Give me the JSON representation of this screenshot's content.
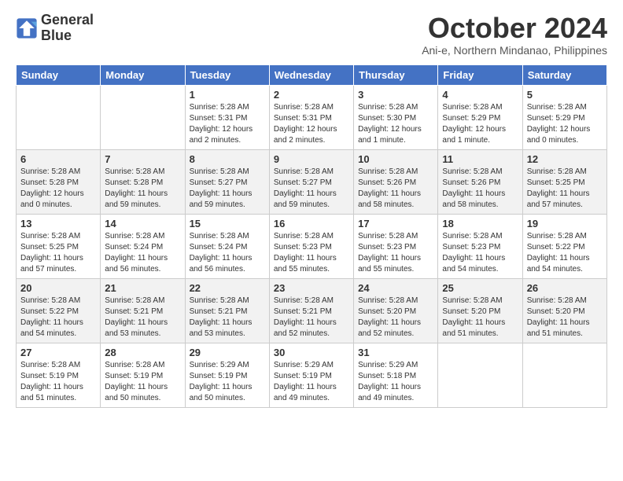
{
  "header": {
    "logo_line1": "General",
    "logo_line2": "Blue",
    "month_title": "October 2024",
    "subtitle": "Ani-e, Northern Mindanao, Philippines"
  },
  "days_of_week": [
    "Sunday",
    "Monday",
    "Tuesday",
    "Wednesday",
    "Thursday",
    "Friday",
    "Saturday"
  ],
  "weeks": [
    [
      {
        "day": "",
        "content": ""
      },
      {
        "day": "",
        "content": ""
      },
      {
        "day": "1",
        "content": "Sunrise: 5:28 AM\nSunset: 5:31 PM\nDaylight: 12 hours and 2 minutes."
      },
      {
        "day": "2",
        "content": "Sunrise: 5:28 AM\nSunset: 5:31 PM\nDaylight: 12 hours and 2 minutes."
      },
      {
        "day": "3",
        "content": "Sunrise: 5:28 AM\nSunset: 5:30 PM\nDaylight: 12 hours and 1 minute."
      },
      {
        "day": "4",
        "content": "Sunrise: 5:28 AM\nSunset: 5:29 PM\nDaylight: 12 hours and 1 minute."
      },
      {
        "day": "5",
        "content": "Sunrise: 5:28 AM\nSunset: 5:29 PM\nDaylight: 12 hours and 0 minutes."
      }
    ],
    [
      {
        "day": "6",
        "content": "Sunrise: 5:28 AM\nSunset: 5:28 PM\nDaylight: 12 hours and 0 minutes."
      },
      {
        "day": "7",
        "content": "Sunrise: 5:28 AM\nSunset: 5:28 PM\nDaylight: 11 hours and 59 minutes."
      },
      {
        "day": "8",
        "content": "Sunrise: 5:28 AM\nSunset: 5:27 PM\nDaylight: 11 hours and 59 minutes."
      },
      {
        "day": "9",
        "content": "Sunrise: 5:28 AM\nSunset: 5:27 PM\nDaylight: 11 hours and 59 minutes."
      },
      {
        "day": "10",
        "content": "Sunrise: 5:28 AM\nSunset: 5:26 PM\nDaylight: 11 hours and 58 minutes."
      },
      {
        "day": "11",
        "content": "Sunrise: 5:28 AM\nSunset: 5:26 PM\nDaylight: 11 hours and 58 minutes."
      },
      {
        "day": "12",
        "content": "Sunrise: 5:28 AM\nSunset: 5:25 PM\nDaylight: 11 hours and 57 minutes."
      }
    ],
    [
      {
        "day": "13",
        "content": "Sunrise: 5:28 AM\nSunset: 5:25 PM\nDaylight: 11 hours and 57 minutes."
      },
      {
        "day": "14",
        "content": "Sunrise: 5:28 AM\nSunset: 5:24 PM\nDaylight: 11 hours and 56 minutes."
      },
      {
        "day": "15",
        "content": "Sunrise: 5:28 AM\nSunset: 5:24 PM\nDaylight: 11 hours and 56 minutes."
      },
      {
        "day": "16",
        "content": "Sunrise: 5:28 AM\nSunset: 5:23 PM\nDaylight: 11 hours and 55 minutes."
      },
      {
        "day": "17",
        "content": "Sunrise: 5:28 AM\nSunset: 5:23 PM\nDaylight: 11 hours and 55 minutes."
      },
      {
        "day": "18",
        "content": "Sunrise: 5:28 AM\nSunset: 5:23 PM\nDaylight: 11 hours and 54 minutes."
      },
      {
        "day": "19",
        "content": "Sunrise: 5:28 AM\nSunset: 5:22 PM\nDaylight: 11 hours and 54 minutes."
      }
    ],
    [
      {
        "day": "20",
        "content": "Sunrise: 5:28 AM\nSunset: 5:22 PM\nDaylight: 11 hours and 54 minutes."
      },
      {
        "day": "21",
        "content": "Sunrise: 5:28 AM\nSunset: 5:21 PM\nDaylight: 11 hours and 53 minutes."
      },
      {
        "day": "22",
        "content": "Sunrise: 5:28 AM\nSunset: 5:21 PM\nDaylight: 11 hours and 53 minutes."
      },
      {
        "day": "23",
        "content": "Sunrise: 5:28 AM\nSunset: 5:21 PM\nDaylight: 11 hours and 52 minutes."
      },
      {
        "day": "24",
        "content": "Sunrise: 5:28 AM\nSunset: 5:20 PM\nDaylight: 11 hours and 52 minutes."
      },
      {
        "day": "25",
        "content": "Sunrise: 5:28 AM\nSunset: 5:20 PM\nDaylight: 11 hours and 51 minutes."
      },
      {
        "day": "26",
        "content": "Sunrise: 5:28 AM\nSunset: 5:20 PM\nDaylight: 11 hours and 51 minutes."
      }
    ],
    [
      {
        "day": "27",
        "content": "Sunrise: 5:28 AM\nSunset: 5:19 PM\nDaylight: 11 hours and 51 minutes."
      },
      {
        "day": "28",
        "content": "Sunrise: 5:28 AM\nSunset: 5:19 PM\nDaylight: 11 hours and 50 minutes."
      },
      {
        "day": "29",
        "content": "Sunrise: 5:29 AM\nSunset: 5:19 PM\nDaylight: 11 hours and 50 minutes."
      },
      {
        "day": "30",
        "content": "Sunrise: 5:29 AM\nSunset: 5:19 PM\nDaylight: 11 hours and 49 minutes."
      },
      {
        "day": "31",
        "content": "Sunrise: 5:29 AM\nSunset: 5:18 PM\nDaylight: 11 hours and 49 minutes."
      },
      {
        "day": "",
        "content": ""
      },
      {
        "day": "",
        "content": ""
      }
    ]
  ]
}
